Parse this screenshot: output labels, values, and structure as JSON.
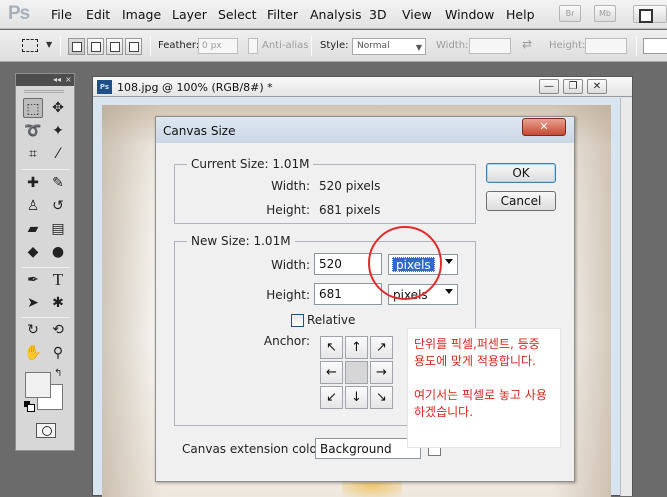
{
  "app": {
    "logo": "Ps",
    "menu": [
      "File",
      "Edit",
      "Image",
      "Layer",
      "Select",
      "Filter",
      "Analysis",
      "3D",
      "View",
      "Window",
      "Help"
    ],
    "mini_buttons": [
      "Br",
      "Mb"
    ]
  },
  "options_bar": {
    "feather_label": "Feather:",
    "feather_value": "0 px",
    "anti_alias_label": "Anti-alias",
    "style_label": "Style:",
    "style_value": "Normal",
    "width_label": "Width:",
    "height_label": "Height:"
  },
  "toolbox": {
    "collapse": "◂◂",
    "close": "×",
    "tools": [
      {
        "name": "rectangular-marquee-tool-icon",
        "glyph": "⬚"
      },
      {
        "name": "move-tool-icon",
        "glyph": "✥"
      },
      {
        "name": "lasso-tool-icon",
        "glyph": "➰"
      },
      {
        "name": "magic-wand-tool-icon",
        "glyph": "✦"
      },
      {
        "name": "crop-tool-icon",
        "glyph": "⌗"
      },
      {
        "name": "eyedropper-tool-icon",
        "glyph": "⁄"
      },
      {
        "name": "healing-brush-tool-icon",
        "glyph": "✚"
      },
      {
        "name": "brush-tool-icon",
        "glyph": "✎"
      },
      {
        "name": "clone-stamp-tool-icon",
        "glyph": "♙"
      },
      {
        "name": "history-brush-tool-icon",
        "glyph": "↺"
      },
      {
        "name": "eraser-tool-icon",
        "glyph": "▰"
      },
      {
        "name": "gradient-tool-icon",
        "glyph": "▤"
      },
      {
        "name": "blur-tool-icon",
        "glyph": "◆"
      },
      {
        "name": "dodge-tool-icon",
        "glyph": "●"
      },
      {
        "name": "pen-tool-icon",
        "glyph": "✒"
      },
      {
        "name": "type-tool-icon",
        "glyph": "T"
      },
      {
        "name": "path-selection-tool-icon",
        "glyph": "➤"
      },
      {
        "name": "custom-shape-tool-icon",
        "glyph": "✱"
      },
      {
        "name": "3d-rotate-tool-icon",
        "glyph": "↻"
      },
      {
        "name": "3d-orbit-tool-icon",
        "glyph": "⟲"
      },
      {
        "name": "hand-tool-icon",
        "glyph": "✋"
      },
      {
        "name": "zoom-tool-icon",
        "glyph": "⚲"
      }
    ]
  },
  "document": {
    "title": "108.jpg @ 100% (RGB/8#) *",
    "ps_badge": "Ps",
    "controls": [
      "—",
      "❐",
      "✕"
    ]
  },
  "dialog": {
    "title": "Canvas Size",
    "close": "✕",
    "current_size": {
      "legend": "Current Size: 1.01M",
      "width_label": "Width:",
      "width_value": "520 pixels",
      "height_label": "Height:",
      "height_value": "681 pixels"
    },
    "new_size": {
      "legend": "New Size: 1.01M",
      "width_label": "Width:",
      "width_value": "520",
      "width_unit": "pixels",
      "height_label": "Height:",
      "height_value": "681",
      "height_unit": "pixels",
      "relative_label": "Relative",
      "anchor_label": "Anchor:",
      "anchor": [
        "↖",
        "↑",
        "↗",
        "←",
        "",
        "→",
        "↙",
        "↓",
        "↘"
      ]
    },
    "extension_label": "Canvas extension color:",
    "extension_value": "Background",
    "ok": "OK",
    "cancel": "Cancel"
  },
  "annotation": {
    "line1": "단위를 픽셀,퍼센트, 등중 용도에 맞게 적용합니다.",
    "line2": "여기서는 픽셀로 놓고 사용하겠습니다.",
    "circle_color": "#e42b2b"
  }
}
